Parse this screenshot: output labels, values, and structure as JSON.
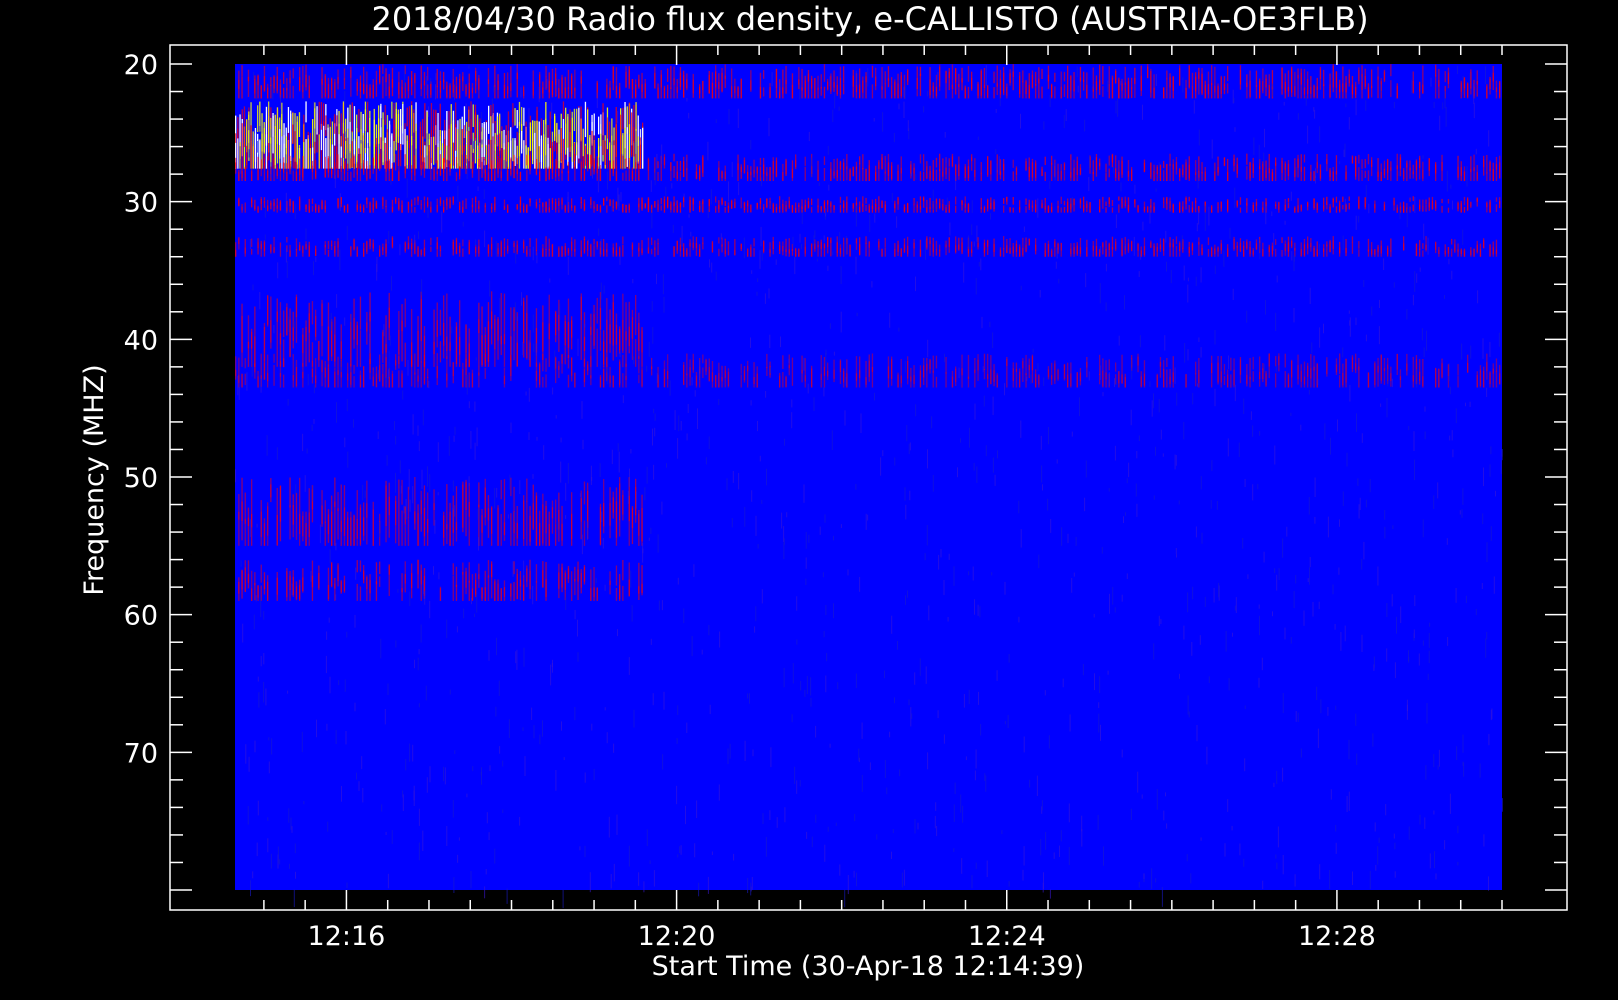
{
  "chart_data": {
    "type": "heatmap",
    "title": "2018/04/30  Radio flux density, e-CALLISTO (AUSTRIA-OE3FLB)",
    "xlabel": "Start Time (30-Apr-18 12:14:39)",
    "ylabel": "Frequency (MHZ)",
    "xlim": [
      "12:14:39",
      "12:30:00"
    ],
    "ylim": [
      20,
      80
    ],
    "y_inverted": true,
    "x_ticks": [
      "12:16",
      "12:20",
      "12:24",
      "12:28"
    ],
    "y_ticks": [
      20,
      30,
      40,
      50,
      60,
      70
    ],
    "colormap": [
      "#0000ff",
      "#ff0000",
      "#ffff00",
      "#ffffff"
    ],
    "background_color": "#0000ff",
    "features": [
      {
        "kind": "broadband-bright",
        "t_start": "12:14:39",
        "t_end": "12:19:36",
        "f_low": 22.7,
        "f_high": 27.6,
        "intensity": 1.0
      },
      {
        "kind": "band-persistent",
        "t_start": "12:14:39",
        "t_end": "12:30:00",
        "f_low": 20.0,
        "f_high": 22.5,
        "intensity": 0.55
      },
      {
        "kind": "band-persistent",
        "t_start": "12:14:39",
        "t_end": "12:30:00",
        "f_low": 26.5,
        "f_high": 28.5,
        "intensity": 0.5
      },
      {
        "kind": "band-persistent",
        "t_start": "12:14:39",
        "t_end": "12:30:00",
        "f_low": 29.6,
        "f_high": 30.8,
        "intensity": 0.6
      },
      {
        "kind": "band-persistent",
        "t_start": "12:14:39",
        "t_end": "12:30:00",
        "f_low": 32.5,
        "f_high": 34.0,
        "intensity": 0.45
      },
      {
        "kind": "band-patch",
        "t_start": "12:14:39",
        "t_end": "12:19:36",
        "f_low": 36.5,
        "f_high": 42.0,
        "intensity": 0.35
      },
      {
        "kind": "band-patch",
        "t_start": "12:14:39",
        "t_end": "12:19:36",
        "f_low": 50.0,
        "f_high": 55.0,
        "intensity": 0.35
      },
      {
        "kind": "band-patch",
        "t_start": "12:14:39",
        "t_end": "12:19:36",
        "f_low": 56.0,
        "f_high": 59.0,
        "intensity": 0.4
      },
      {
        "kind": "band-faint",
        "t_start": "12:14:39",
        "t_end": "12:30:00",
        "f_low": 41.0,
        "f_high": 43.5,
        "intensity": 0.2
      }
    ]
  }
}
